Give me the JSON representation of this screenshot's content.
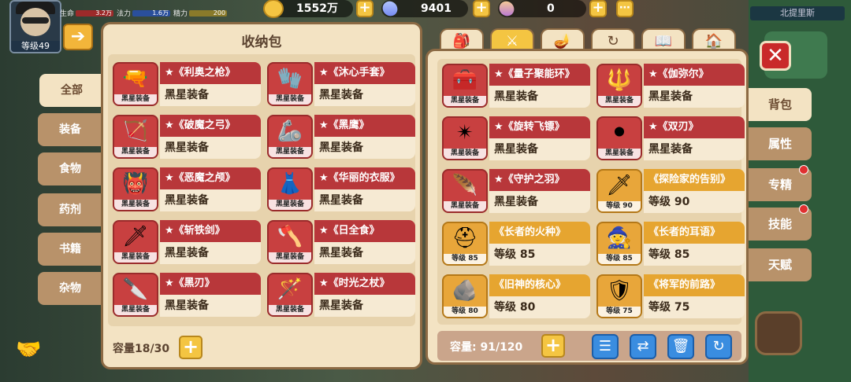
{
  "hud": {
    "avatar_level": "等级49",
    "hp_label": "生命",
    "hp_value": "3.2万",
    "mp_label": "法力",
    "mp_value": "1.6万",
    "sp_label": "精力",
    "sp_value": "200",
    "gold": "1552万",
    "diamond": "9401",
    "crystal": "0",
    "region": "北提里斯"
  },
  "left_panel": {
    "title": "收纳包",
    "capacity": "容量18/30",
    "categories": [
      "全部",
      "装备",
      "食物",
      "药剂",
      "书籍",
      "杂物"
    ],
    "items": [
      {
        "name": "★《利奥之枪》",
        "sub": "黑星装备",
        "tag": "黑星装备",
        "icon": "blaster-gun-icon",
        "glyph": "🔫"
      },
      {
        "name": "★《沐心手套》",
        "sub": "黑星装备",
        "tag": "黑星装备",
        "icon": "glove-icon",
        "glyph": "🧤"
      },
      {
        "name": "★《破魔之弓》",
        "sub": "黑星装备",
        "tag": "黑星装备",
        "icon": "bow-icon",
        "glyph": "🏹"
      },
      {
        "name": "★《黑鹰》",
        "sub": "黑星装备",
        "tag": "黑星装备",
        "icon": "gauntlet-icon",
        "glyph": "🦾"
      },
      {
        "name": "★《恶魔之颅》",
        "sub": "黑星装备",
        "tag": "黑星装备",
        "icon": "demon-skull-icon",
        "glyph": "👹"
      },
      {
        "name": "★《华丽的衣服》",
        "sub": "黑星装备",
        "tag": "黑星装备",
        "icon": "dress-icon",
        "glyph": "👗"
      },
      {
        "name": "★《斩铁剑》",
        "sub": "黑星装备",
        "tag": "黑星装备",
        "icon": "katana-icon",
        "glyph": "🗡"
      },
      {
        "name": "★《日全食》",
        "sub": "黑星装备",
        "tag": "黑星装备",
        "icon": "spiked-axe-icon",
        "glyph": "🪓"
      },
      {
        "name": "★《黑刃》",
        "sub": "黑星装备",
        "tag": "黑星装备",
        "icon": "black-blade-icon",
        "glyph": "🔪"
      },
      {
        "name": "★《时光之杖》",
        "sub": "黑星装备",
        "tag": "黑星装备",
        "icon": "staff-icon",
        "glyph": "🪄"
      }
    ]
  },
  "right_panel": {
    "capacity": "容量: 91/120",
    "top_tabs": [
      {
        "icon": "backpack-icon",
        "glyph": "🎒"
      },
      {
        "icon": "sword-icon",
        "glyph": "⚔"
      },
      {
        "icon": "lamp-icon",
        "glyph": "🪔"
      },
      {
        "icon": "refresh-ring-icon",
        "glyph": "↻"
      },
      {
        "icon": "book-icon",
        "glyph": "📖"
      },
      {
        "icon": "house-icon",
        "glyph": "🏠"
      }
    ],
    "side_tabs": [
      "背包",
      "属性",
      "专精",
      "技能",
      "天赋"
    ],
    "items": [
      {
        "name": "★《量子聚能环》",
        "sub": "黑星装备",
        "tag": "黑星装备",
        "icon": "quantum-ring-icon",
        "glyph": "🧰",
        "gold": false
      },
      {
        "name": "★《伽弥尔》",
        "sub": "黑星装备",
        "tag": "黑星装备",
        "icon": "trident-icon",
        "glyph": "🔱",
        "gold": false
      },
      {
        "name": "★《旋转飞镖》",
        "sub": "黑星装备",
        "tag": "黑星装备",
        "icon": "shuriken-icon",
        "glyph": "✴",
        "gold": false
      },
      {
        "name": "★《双刃》",
        "sub": "黑星装备",
        "tag": "黑星装备",
        "icon": "twin-blade-icon",
        "glyph": "⚫",
        "gold": false
      },
      {
        "name": "★《守护之羽》",
        "sub": "黑星装备",
        "tag": "黑星装备",
        "icon": "feather-icon",
        "glyph": "🪶",
        "gold": false
      },
      {
        "name": "《探险家的告别》",
        "sub": "等级 90",
        "tag": "等级 90",
        "icon": "dagger-icon",
        "glyph": "🗡",
        "gold": true
      },
      {
        "name": "《长者的火种》",
        "sub": "等级 85",
        "tag": "等级 85",
        "icon": "iron-helmet-icon",
        "glyph": "⛑",
        "gold": true
      },
      {
        "name": "《长者的耳语》",
        "sub": "等级 85",
        "tag": "等级 85",
        "icon": "purple-hood-icon",
        "glyph": "🧙",
        "gold": true
      },
      {
        "name": "《旧神的核心》",
        "sub": "等级 80",
        "tag": "等级 80",
        "icon": "stone-core-icon",
        "glyph": "🪨",
        "gold": true
      },
      {
        "name": "《将军的前路》",
        "sub": "等级 75",
        "tag": "等级 75",
        "icon": "general-armor-icon",
        "glyph": "🛡",
        "gold": true
      }
    ],
    "tools": [
      {
        "icon": "list-sort-icon",
        "glyph": "☰"
      },
      {
        "icon": "swap-icon",
        "glyph": "⇄"
      },
      {
        "icon": "trash-icon",
        "glyph": "🗑"
      },
      {
        "icon": "refresh-icon",
        "glyph": "↻"
      }
    ]
  }
}
